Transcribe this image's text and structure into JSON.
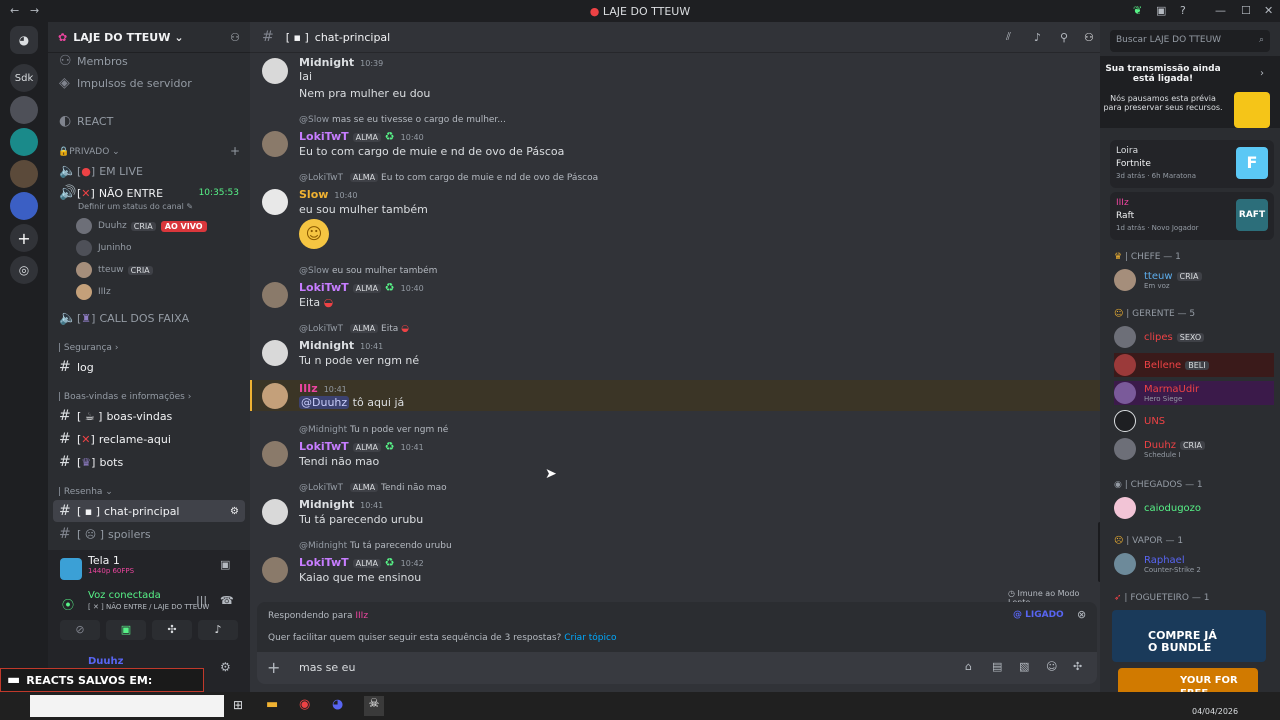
{
  "window": {
    "title": "LAJE DO TTEUW"
  },
  "server": {
    "name": "LAJE DO TTEUW",
    "sdk_label": "Sdk"
  },
  "sidebar": {
    "top_items": [
      "Membros",
      "Impulsos de servidor"
    ],
    "react_label": "REACT",
    "cat_privado": "PRIVADO",
    "ch_em_live": "EM LIVE",
    "ch_nao_entre": "NÃO ENTRE",
    "nao_entre_timer": "10:35:53",
    "status_hint": "Definir um status do canal",
    "voice_users": [
      {
        "name": "Duuhz",
        "tag": "CRIA",
        "badge": "AO VIVO"
      },
      {
        "name": "Juninho",
        "tag": "",
        "badge": ""
      },
      {
        "name": "tteuw",
        "tag": "CRIA",
        "badge": ""
      },
      {
        "name": "IIIz",
        "tag": "",
        "badge": ""
      }
    ],
    "ch_call": "CALL DOS FAIXA",
    "cat_seguranca": "| Segurança",
    "ch_log": "log",
    "cat_boas": "| Boas-vindas e informações",
    "ch_boas": "boas-vindas",
    "ch_reclame": "reclame-aqui",
    "ch_bots": "bots",
    "cat_resenha": "| Resenha",
    "ch_chat": "chat-principal",
    "ch_spoilers": "spoilers"
  },
  "voice": {
    "stream_title": "Tela 1",
    "stream_quality": "1440p 60FPS",
    "connected": "Voz conectada",
    "location": "NÃO ENTRE / LAJE DO TTEUW",
    "user": "Duuhz",
    "overlay": "REACTS SALVOS EM:"
  },
  "chat": {
    "channel": "chat-principal",
    "messages": [
      {
        "author": "Midnight",
        "time": "10:39",
        "lines": [
          "Iai",
          "Nem pra mulher eu dou"
        ],
        "reply": "",
        "reply_text": "",
        "role": "",
        "color": "#dbdee1"
      },
      {
        "author": "LokiTwT",
        "time": "10:40",
        "lines": [
          "Eu to com cargo de muie e nd de ovo de Páscoa"
        ],
        "reply": "@Slow",
        "reply_text": "mas se eu tivesse o cargo de mulher...",
        "role": "ALMA",
        "color": "#c77dff"
      },
      {
        "author": "Slow",
        "time": "10:40",
        "lines": [
          "eu sou mulher também"
        ],
        "reply": "@LokiTwT",
        "reply_text": "Eu to com cargo de muie e nd de ovo de Páscoa",
        "role": "",
        "color": "#f0b232"
      },
      {
        "author": "LokiTwT",
        "time": "10:40",
        "lines": [
          "Eita"
        ],
        "reply": "@Slow",
        "reply_text": "eu sou mulher também",
        "role": "ALMA",
        "color": "#c77dff"
      },
      {
        "author": "Midnight",
        "time": "10:41",
        "lines": [
          "Tu n pode ver ngm né"
        ],
        "reply": "@LokiTwT",
        "reply_text": "Eita",
        "role": "",
        "color": "#dbdee1"
      },
      {
        "author": "IIIz",
        "time": "10:41",
        "lines": [
          "tô aqui já"
        ],
        "reply": "",
        "reply_text": "",
        "role": "",
        "color": "#eb459e",
        "mention": "@Duuhz"
      },
      {
        "author": "LokiTwT",
        "time": "10:41",
        "lines": [
          "Tendi não mao"
        ],
        "reply": "@Midnight",
        "reply_text": "Tu n pode ver ngm né",
        "role": "ALMA",
        "color": "#c77dff"
      },
      {
        "author": "Midnight",
        "time": "10:41",
        "lines": [
          "Tu tá parecendo urubu"
        ],
        "reply": "@LokiTwT",
        "reply_text": "Tendi não mao",
        "role": "",
        "color": "#dbdee1"
      },
      {
        "author": "LokiTwT",
        "time": "10:42",
        "lines": [
          "Kaiao que me ensinou"
        ],
        "reply": "@Midnight",
        "reply_text": "Tu tá parecendo urubu",
        "role": "ALMA",
        "color": "#c77dff"
      }
    ],
    "slowmode": "Imune ao Modo Lento",
    "replying_to": "Respondendo para",
    "replying_user": "IIIz",
    "mention_toggle": "@ LIGADO",
    "thread_hint": "Quer facilitar quem quiser seguir esta sequência de 3 respostas?",
    "thread_link": "Criar tópico",
    "input_value": "mas se eu"
  },
  "search": {
    "placeholder": "Buscar LAJE DO TTEUW"
  },
  "members": {
    "stream_notice_title": "Sua transmissão ainda está ligada!",
    "stream_notice_body": "Nós pausamos esta prévia para preservar seus recursos.",
    "activities": [
      {
        "user": "Loira",
        "game": "Fortnite",
        "ago": "3d atrás",
        "info": "6h Maratona"
      },
      {
        "user": "IIIz",
        "game": "Raft",
        "ago": "1d atrás",
        "info": "Novo Jogador"
      }
    ],
    "groups": [
      {
        "label": "| CHEFE — 1",
        "members": [
          {
            "name": "tteuw",
            "sub": "Em voz",
            "color": "#5dadec",
            "tag": "CRIA"
          }
        ]
      },
      {
        "label": "| GERENTE — 5",
        "members": [
          {
            "name": "clipes",
            "sub": "",
            "color": "#ed4245",
            "tag": "SEXO"
          },
          {
            "name": "Bellene",
            "sub": "",
            "color": "#ed4245",
            "tag": "BELI"
          },
          {
            "name": "MarmaUdir",
            "sub": "Hero Siege",
            "color": "#ed4245",
            "tag": ""
          },
          {
            "name": "UNS",
            "sub": "",
            "color": "#ed4245",
            "tag": ""
          },
          {
            "name": "Duuhz",
            "sub": "Schedule I",
            "color": "#ed4245",
            "tag": "CRIA"
          }
        ]
      },
      {
        "label": "| CHEGADOS — 1",
        "members": [
          {
            "name": "caiodugozo",
            "sub": "",
            "color": "#57f287",
            "tag": ""
          }
        ]
      },
      {
        "label": "| VAPOR — 1",
        "members": [
          {
            "name": "Raphael",
            "sub": "Counter-Strike 2",
            "color": "#5865f2",
            "tag": ""
          }
        ]
      },
      {
        "label": "| FOGUETEIRO — 1",
        "members": []
      }
    ],
    "ad_text": "COMPRE JÁ O BUNDLE",
    "promo_text": "YOUR FOR FREE"
  },
  "taskbar": {
    "date": "04/04/2026"
  }
}
